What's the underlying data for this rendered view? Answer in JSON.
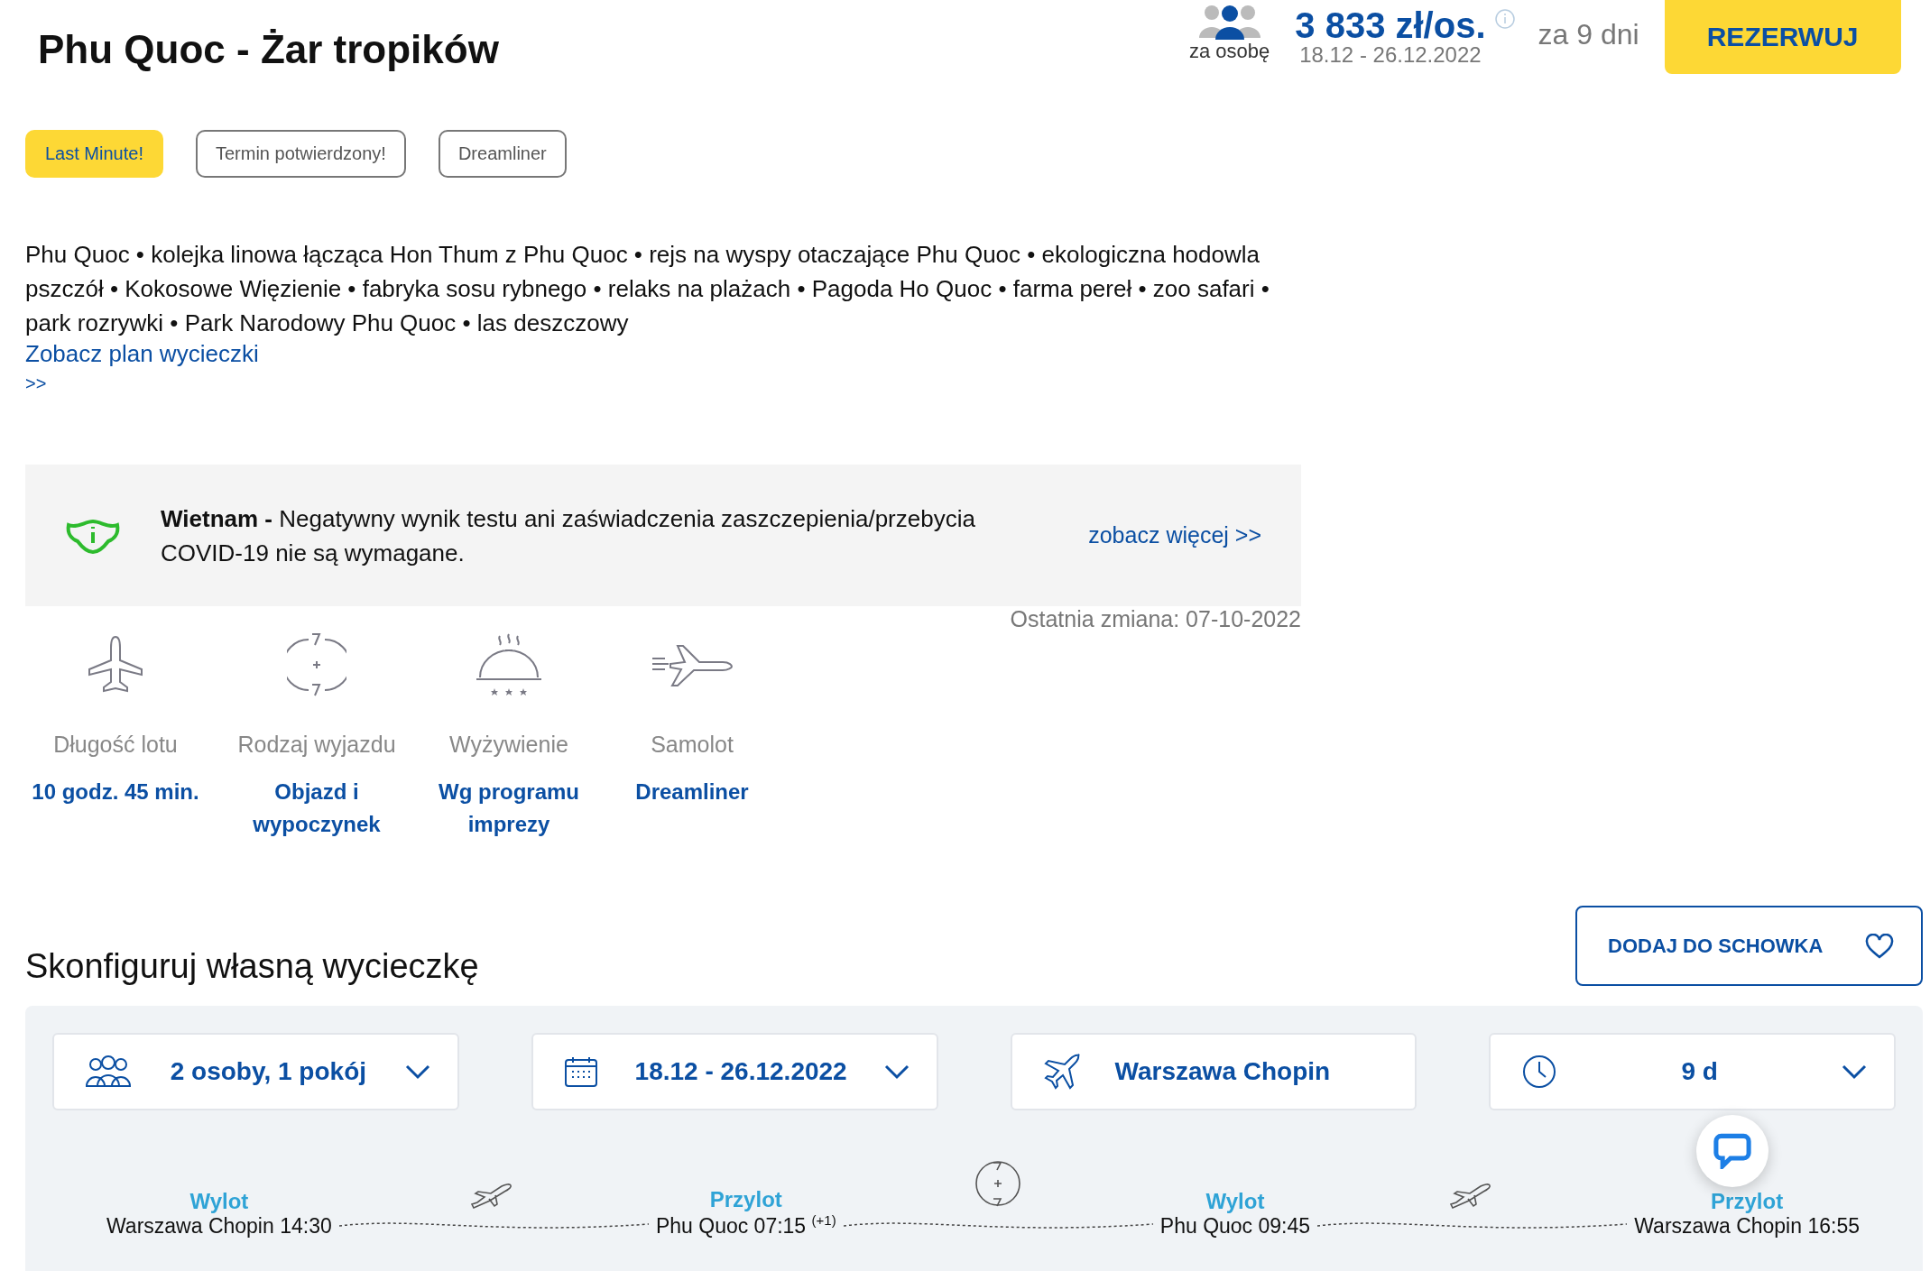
{
  "header": {
    "title": "Phu Quoc - Żar tropików",
    "per_person_label": "za osobę",
    "price": "3 833 zł/os.",
    "dates": "18.12 - 26.12.2022",
    "duration": "za 9 dni",
    "book_button": "REZERWUJ"
  },
  "tags": [
    {
      "label": "Last Minute!",
      "kind": "highlight"
    },
    {
      "label": "Termin potwierdzony!",
      "kind": "outline"
    },
    {
      "label": "Dreamliner",
      "kind": "outline"
    }
  ],
  "description": "Phu Quoc • kolejka linowa łącząca Hon Thum z Phu Quoc • rejs na wyspy otaczające Phu Quoc • ekologiczna hodowla pszczół • Kokosowe Więzienie • fabryka sosu rybnego • relaks na plażach • Pagoda Ho Quoc • farma pereł • zoo safari • park rozrywki • Park Narodowy Phu Quoc • las deszczowy",
  "plan_link": "Zobacz plan wycieczki",
  "plan_link_arrows": ">>",
  "notice": {
    "text": "**Wietnam -** Negatywny wynik testu ani zaświadczenia zaszczepienia/przebycia COVID-19 nie są wymagane.",
    "link": "zobacz więcej >>"
  },
  "last_change": "Ostatnia zmiana: 07-10-2022",
  "features": [
    {
      "kind": "flight",
      "label": "Długość lotu",
      "value": "10 godz. 45 min."
    },
    {
      "kind": "trip_type",
      "label": "Rodzaj wyjazdu",
      "value": "Objazd i wypoczynek"
    },
    {
      "kind": "meals",
      "label": "Wyżywienie",
      "value": "Wg programu imprezy"
    },
    {
      "kind": "aircraft",
      "label": "Samolot",
      "value": "Dreamliner"
    }
  ],
  "configurator": {
    "title": "Skonfiguruj własną wycieczkę",
    "save_button": "DODAJ DO SCHOWKA",
    "selectors": [
      {
        "kind": "travelers",
        "value": "2 osoby, 1 pokój",
        "dropdown": true
      },
      {
        "kind": "dates",
        "value": "18.12 - 26.12.2022",
        "dropdown": true
      },
      {
        "kind": "departure",
        "value": "Warszawa Chopin",
        "dropdown": false
      },
      {
        "kind": "duration",
        "value": "9 d",
        "dropdown": true
      }
    ],
    "timeline": [
      {
        "label": "Wylot",
        "place": "Warszawa Chopin 14:30"
      },
      {
        "label": "Przylot",
        "place": "Phu Quoc 07:15 $^{(+1)}$"
      },
      {
        "label": "Wylot",
        "place": "Phu Quoc 09:45"
      },
      {
        "label": "Przylot",
        "place": "Warszawa Chopin 16:55"
      }
    ],
    "connectors": [
      {
        "kind": "flight"
      },
      {
        "kind": "stay"
      },
      {
        "kind": "flight"
      }
    ]
  }
}
